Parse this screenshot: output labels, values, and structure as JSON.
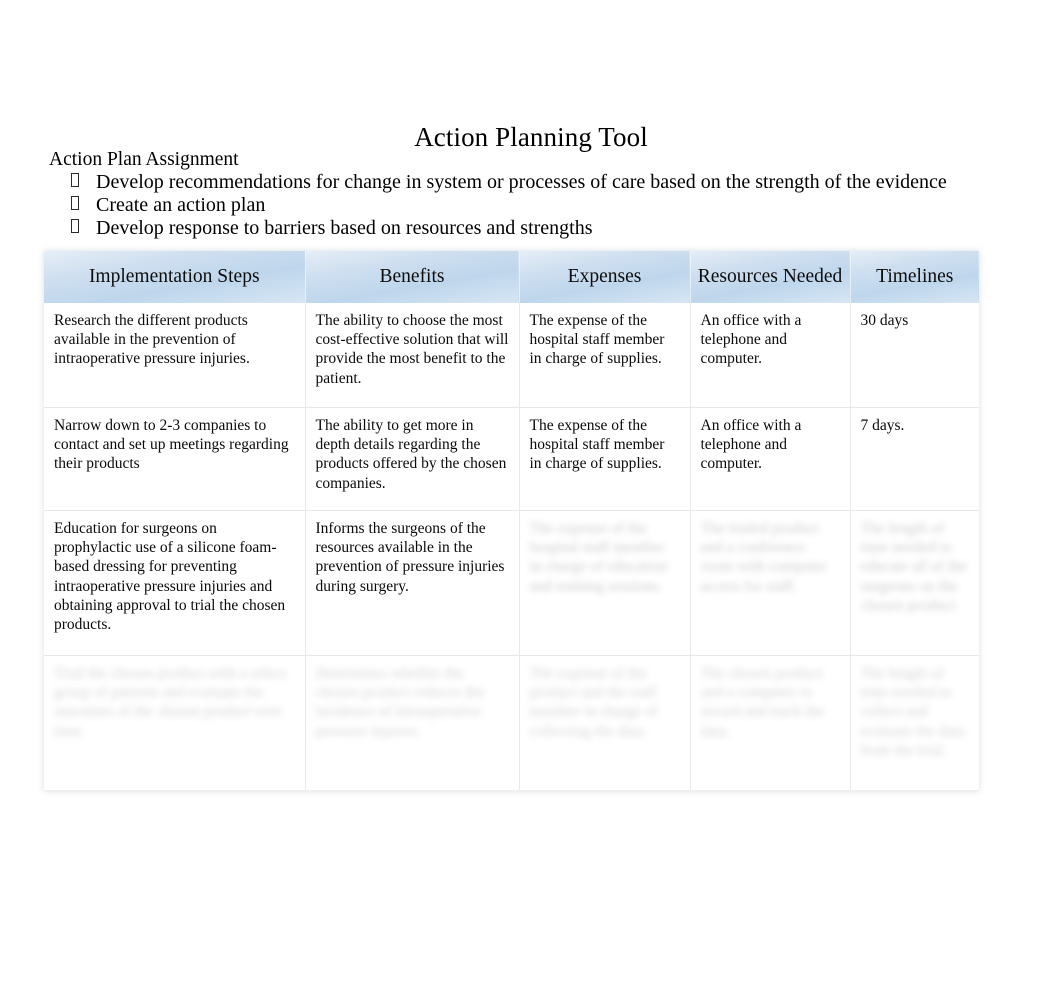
{
  "document": {
    "title": "Action Planning Tool",
    "assignment_heading": "Action Plan Assignment",
    "bullets": [
      "Develop recommendations for change in system or processes of care based on the strength of the evidence",
      "Create an action plan",
      "Develop response to barriers based on resources and strengths"
    ],
    "bullet_glyph": "missing-glyph-box"
  },
  "table": {
    "headers": [
      "Implementation Steps",
      "Benefits",
      "Expenses",
      "Resources Needed",
      "Timelines"
    ],
    "header_fill": "#bed6ec",
    "rows": [
      {
        "legible": true,
        "cells": [
          "Research the different products available in the prevention of intraoperative pressure injuries.",
          "The ability to choose the most cost-effective solution that will provide the most benefit to the patient.",
          "The expense of the hospital staff member in charge of supplies.",
          "An office with a telephone and computer.",
          "30 days"
        ]
      },
      {
        "legible": true,
        "cells": [
          "Narrow down to 2-3 companies to contact and set up meetings regarding their products",
          "The ability to get more in depth details regarding the products offered by the chosen companies.",
          "The expense of the hospital staff member in charge of supplies.",
          "An office with a telephone and computer.",
          "7 days."
        ]
      },
      {
        "legible": "partial",
        "cells": [
          "Education for surgeons on prophylactic use of a silicone foam-based dressing for preventing intraoperative pressure injuries and obtaining approval to trial the chosen products.",
          "Informs the surgeons of the resources available in the prevention of pressure injuries during surgery.",
          "",
          "",
          ""
        ],
        "blurred_cells": [
          2,
          3,
          4
        ]
      },
      {
        "legible": false,
        "cells": [
          "",
          "",
          "",
          "",
          ""
        ],
        "blurred_cells": [
          0,
          1,
          2,
          3,
          4
        ]
      }
    ]
  }
}
